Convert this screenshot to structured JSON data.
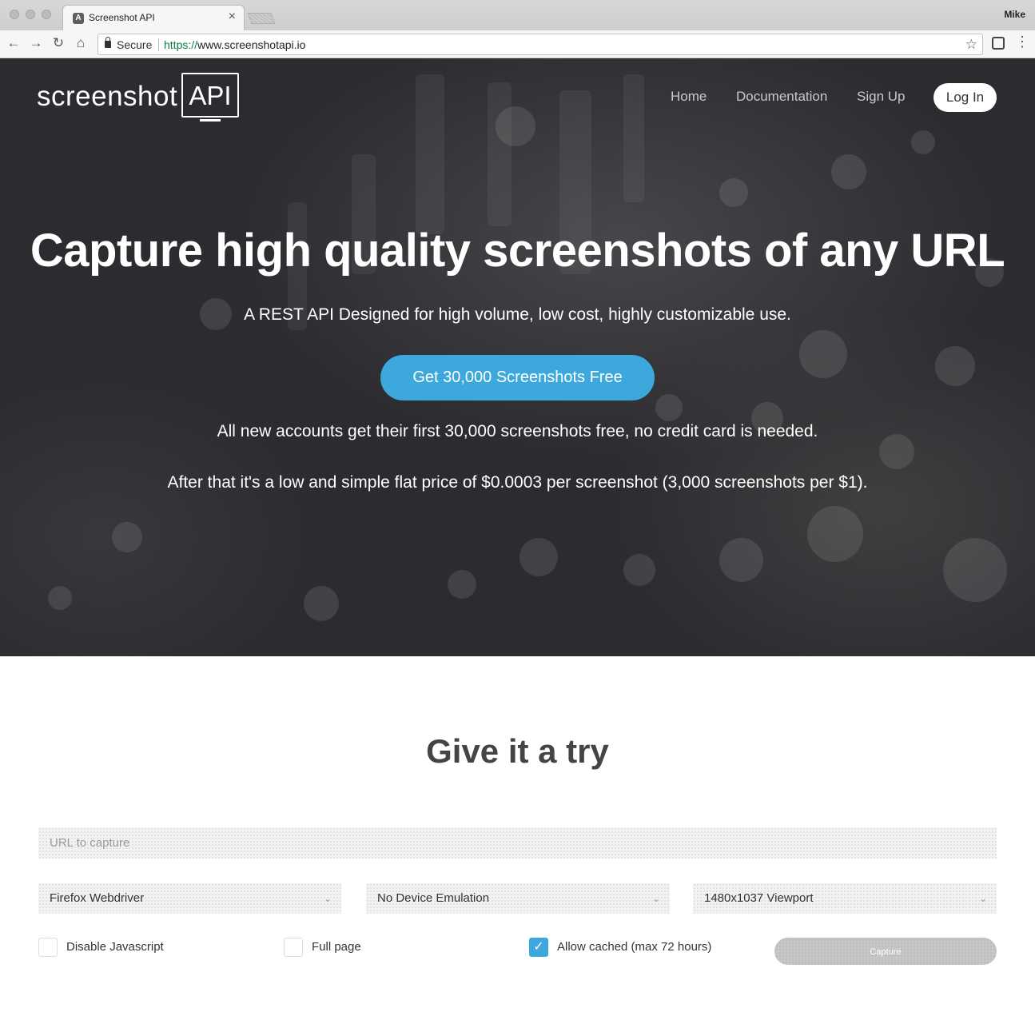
{
  "browser": {
    "tab_title": "Screenshot API",
    "tab_icon": "angular-icon",
    "profile_name": "Mike",
    "secure_label": "Secure",
    "url_protocol": "https://",
    "url_host": "www.screenshotapi.io"
  },
  "header": {
    "logo_word": "screenshot",
    "logo_box": "API",
    "nav": [
      "Home",
      "Documentation",
      "Sign Up"
    ],
    "login_label": "Log In"
  },
  "hero": {
    "title": "Capture high quality screenshots of any URL",
    "subtitle": "A REST API Designed for high volume, low cost, highly customizable use.",
    "cta_label": "Get 30,000 Screenshots Free",
    "note1": "All new accounts get their first 30,000 screenshots free, no credit card is needed.",
    "note2": "After that it's a low and simple flat price of $0.0003 per screenshot (3,000 screenshots per $1)."
  },
  "try": {
    "title": "Give it a try",
    "url_placeholder": "URL to capture",
    "browser_select": "Firefox Webdriver",
    "device_select": "No Device Emulation",
    "viewport_select": "1480x1037 Viewport",
    "options": [
      {
        "label": "Disable Javascript",
        "checked": false
      },
      {
        "label": "Full page",
        "checked": false
      },
      {
        "label": "Allow cached (max 72 hours)",
        "checked": true
      }
    ],
    "capture_label": "Capture"
  },
  "colors": {
    "accent": "#3da8db",
    "hero_bg": "#2b2b30",
    "heading": "#444444"
  }
}
